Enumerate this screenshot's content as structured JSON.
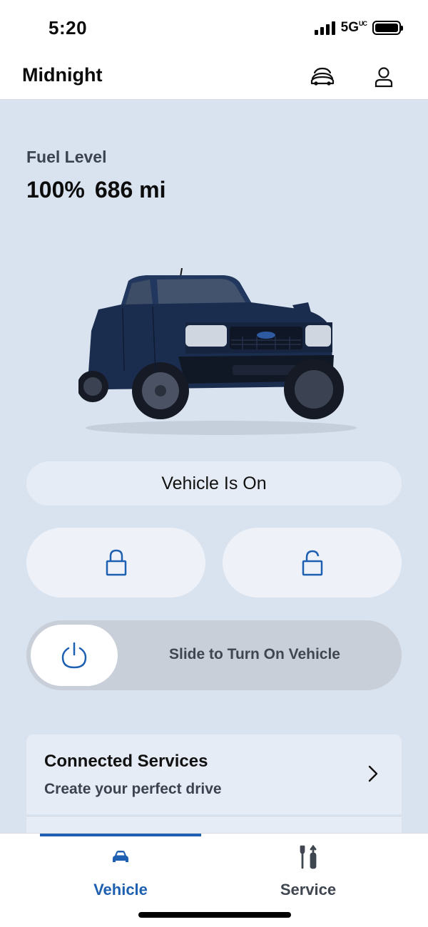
{
  "status_bar": {
    "time": "5:20",
    "network": "5G",
    "network_superscript": "UC",
    "battery_icon": "battery-full-icon"
  },
  "header": {
    "title": "Midnight",
    "icons": [
      "garage-cars-icon",
      "user-account-icon"
    ]
  },
  "fuel": {
    "label": "Fuel Level",
    "percent": "100%",
    "range": "686 mi"
  },
  "vehicle": {
    "image_description_icon": "pickup-truck-image",
    "status_text": "Vehicle Is On"
  },
  "controls": {
    "lock_icon": "lock-closed-icon",
    "unlock_icon": "lock-open-icon",
    "slider_icon": "power-icon",
    "slider_label": "Slide to Turn On Vehicle"
  },
  "services": {
    "title": "Connected Services",
    "subtitle": "Create your perfect drive",
    "chevron_icon": "chevron-right-icon"
  },
  "nav": {
    "items": [
      {
        "label": "Vehicle",
        "icon": "car-icon",
        "active": true
      },
      {
        "label": "Service",
        "icon": "tools-icon",
        "active": false
      }
    ]
  },
  "colors": {
    "accent": "#1d5fb0",
    "background": "#d9e2ef",
    "card": "#e6ecf5",
    "slider_track": "#c9cfd9",
    "inactive_nav": "#3f4650"
  }
}
